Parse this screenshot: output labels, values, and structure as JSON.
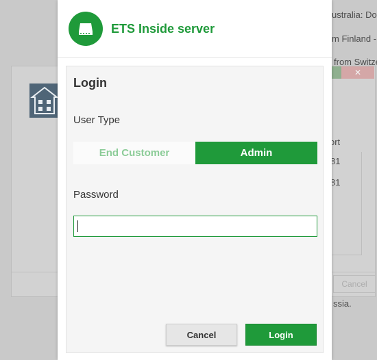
{
  "background": {
    "lines": [
      "ustralia: Dor",
      "m Finland -",
      "from Switze",
      "ort",
      "81",
      "81",
      "ssia."
    ],
    "close_symbol": "✕",
    "cancel_label": "Cancel"
  },
  "dialog": {
    "app_title": "ETS Inside server",
    "logo_icon": "server-drive-icon",
    "heading": "Login",
    "user_type_label": "User Type",
    "user_types": [
      "End Customer",
      "Admin"
    ],
    "selected_user_type": "Admin",
    "password_label": "Password",
    "password_value": "",
    "password_placeholder": "",
    "cancel_label": "Cancel",
    "login_label": "Login"
  },
  "colors": {
    "accent": "#1f9a3a",
    "accent_light_text": "#8ccc98",
    "panel_bg": "#f5f5f5"
  }
}
